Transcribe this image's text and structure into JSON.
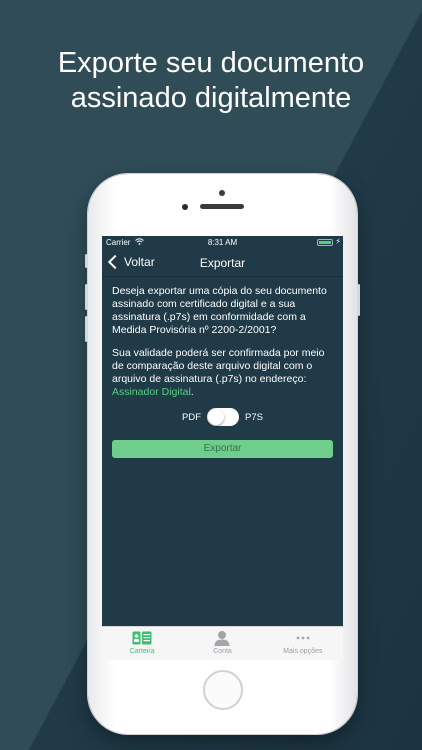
{
  "headline": {
    "line1": "Exporte seu documento",
    "line2": "assinado digitalmente"
  },
  "status_bar": {
    "carrier": "Carrier",
    "time": "8:31 AM"
  },
  "nav": {
    "back_label": "Voltar",
    "title": "Exportar"
  },
  "content": {
    "paragraph1": "Deseja exportar uma cópia do seu documento assinado com certificado digital e a sua assinatura (.p7s) em conformidade com a Medida Provisória nº 2200-2/2001?",
    "paragraph2_prefix": "Sua validade poderá ser confirmada por meio de comparação deste arquivo digital com o arquivo de assinatura (.p7s) no endereço: ",
    "link_text": "Assinador Digital",
    "paragraph2_suffix": "."
  },
  "toggle": {
    "left_label": "PDF",
    "right_label": "P7S"
  },
  "export_button": "Exportar",
  "tabs": [
    {
      "label": "Carteira",
      "icon": "wallet-card-icon",
      "active": true
    },
    {
      "label": "Conta",
      "icon": "person-icon",
      "active": false
    },
    {
      "label": "Mais opções",
      "icon": "more-dots-icon",
      "active": false
    }
  ],
  "colors": {
    "accent": "#3cbf72",
    "link": "#54d184",
    "screen_bg": "#203a47",
    "page_bg": "#23404d"
  }
}
